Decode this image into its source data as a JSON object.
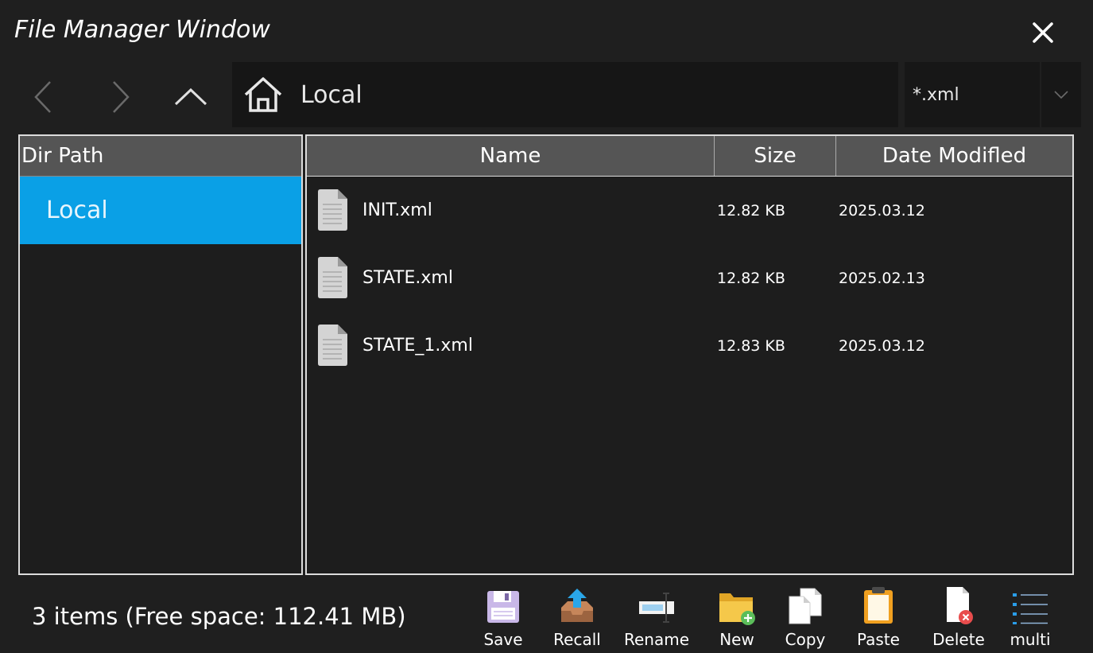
{
  "window": {
    "title": "File Manager Window"
  },
  "nav": {
    "path": "Local",
    "filter": "*.xml"
  },
  "dir_panel": {
    "header": "Dir Path",
    "items": [
      {
        "label": "Local",
        "selected": true
      }
    ]
  },
  "file_list": {
    "columns": [
      "Name",
      "Size",
      "Date Modifled"
    ],
    "rows": [
      {
        "name": "INIT.xml",
        "size": "12.82 KB",
        "date": "2025.03.12"
      },
      {
        "name": "STATE.xml",
        "size": "12.82 KB",
        "date": "2025.02.13"
      },
      {
        "name": "STATE_1.xml",
        "size": "12.83 KB",
        "date": "2025.03.12"
      }
    ]
  },
  "footer": {
    "status": "3 items (Free space: 112.41 MB)",
    "tools": [
      {
        "label": "Save",
        "icon": "floppy-disk-icon"
      },
      {
        "label": "Recall",
        "icon": "recall-tray-icon"
      },
      {
        "label": "Rename",
        "icon": "rename-icon"
      },
      {
        "label": "New",
        "icon": "new-folder-icon"
      },
      {
        "label": "Copy",
        "icon": "copy-icon"
      },
      {
        "label": "Paste",
        "icon": "paste-clipboard-icon"
      },
      {
        "label": "Delete",
        "icon": "delete-file-icon"
      },
      {
        "label": "multi",
        "icon": "multi-select-list-icon"
      }
    ]
  },
  "colors": {
    "background": "#1f1f1f",
    "header": "#555555",
    "selection": "#0aa0e6",
    "panel_border": "#dcdcdc"
  }
}
